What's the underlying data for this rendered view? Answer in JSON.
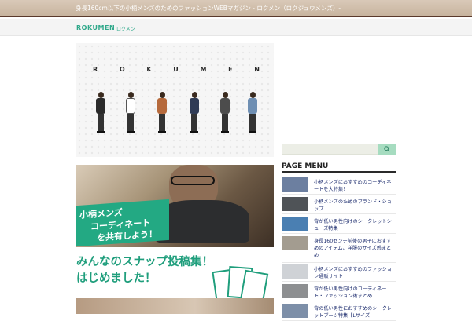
{
  "topbar": {
    "tagline": "身長160cm以下の小柄メンズのためのファッションWEBマガジン - ロクメン（ロクジュウメンズ）-"
  },
  "header": {
    "logo": "ROKUMEN",
    "logo_sub": "ロクメン"
  },
  "hero_banner": {
    "letters": [
      "R",
      "O",
      "K",
      "U",
      "M",
      "E",
      "N"
    ],
    "figure_colors": [
      "#2b2b2b",
      "#ffffff",
      "#b66a3c",
      "#2f3b55",
      "#4c4c4c",
      "#6f8fb3"
    ]
  },
  "snap_banner": {
    "label_lines": [
      "小柄メンズ",
      "コーディネート",
      "を共有しよう！"
    ],
    "headline_1": "みんなのスナップ投稿集！",
    "headline_2": "はじめました！",
    "accent_color": "#23a983"
  },
  "sidebar": {
    "search_icon": "search-icon",
    "menu_title": "PAGE MENU",
    "items": [
      {
        "label": "小柄メンズにおすすめのコーディネートを大特集！",
        "thumb_color": "#6c7fa0"
      },
      {
        "label": "小柄メンズのためのブランド・ショップ",
        "thumb_color": "#4f5357"
      },
      {
        "label": "背が低い男性向けのシークレットシューズ特集",
        "thumb_color": "#4a7fb2"
      },
      {
        "label": "身長160センチ前後の男子におすすめのアイテム、洋服のサイズ感まとめ",
        "thumb_color": "#a39c90"
      },
      {
        "label": "小柄メンズにおすすめのファッション通販サイト",
        "thumb_color": "#cfd2d6"
      },
      {
        "label": "背が低い男性向けのコーディネート・ファッション術まとめ",
        "thumb_color": "#8d8f91"
      },
      {
        "label": "背の低い男性におすすめのシークレットブーツ特集【Lサイズ",
        "thumb_color": "#7d8fa8"
      }
    ]
  },
  "colors": {
    "brand_green": "#2fa88a",
    "link_navy": "#1a2a6c",
    "topbar_border": "#5a3a2c"
  }
}
